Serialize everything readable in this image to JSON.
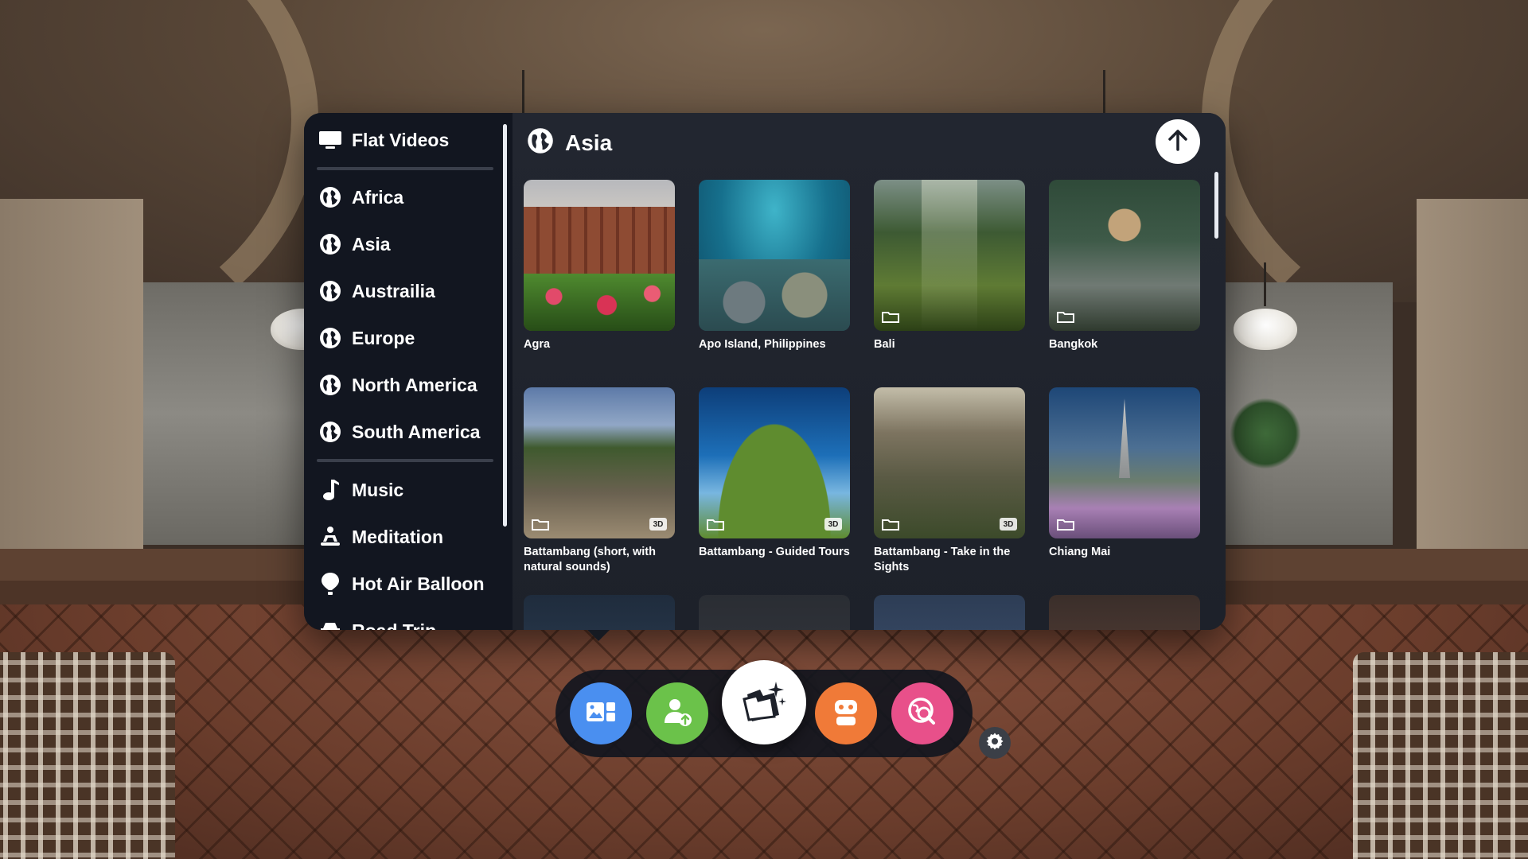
{
  "sidebar": {
    "header": {
      "label": "Flat Videos",
      "icon": "monitor-icon"
    },
    "regions": [
      {
        "label": "Africa",
        "icon": "globe-icon"
      },
      {
        "label": "Asia",
        "icon": "globe-icon"
      },
      {
        "label": "Austrailia",
        "icon": "globe-icon"
      },
      {
        "label": "Europe",
        "icon": "globe-icon"
      },
      {
        "label": "North America",
        "icon": "globe-icon"
      },
      {
        "label": "South America",
        "icon": "globe-icon"
      }
    ],
    "categories": [
      {
        "label": "Music",
        "icon": "music-note-icon"
      },
      {
        "label": "Meditation",
        "icon": "meditation-icon"
      },
      {
        "label": "Hot Air Balloon",
        "icon": "balloon-icon"
      },
      {
        "label": "Road Trip",
        "icon": "car-icon"
      }
    ]
  },
  "content": {
    "title": "Asia",
    "title_icon": "globe-icon",
    "up_button_icon": "arrow-up-icon",
    "tiles": [
      {
        "label": "Agra",
        "badge_3d": false
      },
      {
        "label": "Apo Island, Philippines",
        "badge_3d": false
      },
      {
        "label": "Bali",
        "badge_3d": false
      },
      {
        "label": "Bangkok",
        "badge_3d": false
      },
      {
        "label": "Battambang  (short, with natural sounds)",
        "badge_3d": true,
        "badge_text": "3D"
      },
      {
        "label": "Battambang - Guided Tours",
        "badge_3d": true,
        "badge_text": "3D"
      },
      {
        "label": "Battambang - Take in the Sights",
        "badge_3d": true,
        "badge_text": "3D"
      },
      {
        "label": "Chiang Mai",
        "badge_3d": false
      }
    ]
  },
  "dock": {
    "buttons": [
      {
        "icon": "gallery-icon",
        "color": "#4a8ff0",
        "active": false
      },
      {
        "icon": "user-upload-icon",
        "color": "#6bc24a",
        "active": false
      },
      {
        "icon": "sparkle-folder-icon",
        "color": "#ffffff",
        "active": true
      },
      {
        "icon": "robot-icon",
        "color": "#f07a38",
        "active": false
      },
      {
        "icon": "search-globe-icon",
        "color": "#e8508a",
        "active": false
      }
    ],
    "settings_icon": "gear-icon"
  },
  "colors": {
    "panel_bg": "#161a22",
    "sidebar_bg": "#121620",
    "content_bg": "#222630",
    "text": "#ffffff"
  }
}
